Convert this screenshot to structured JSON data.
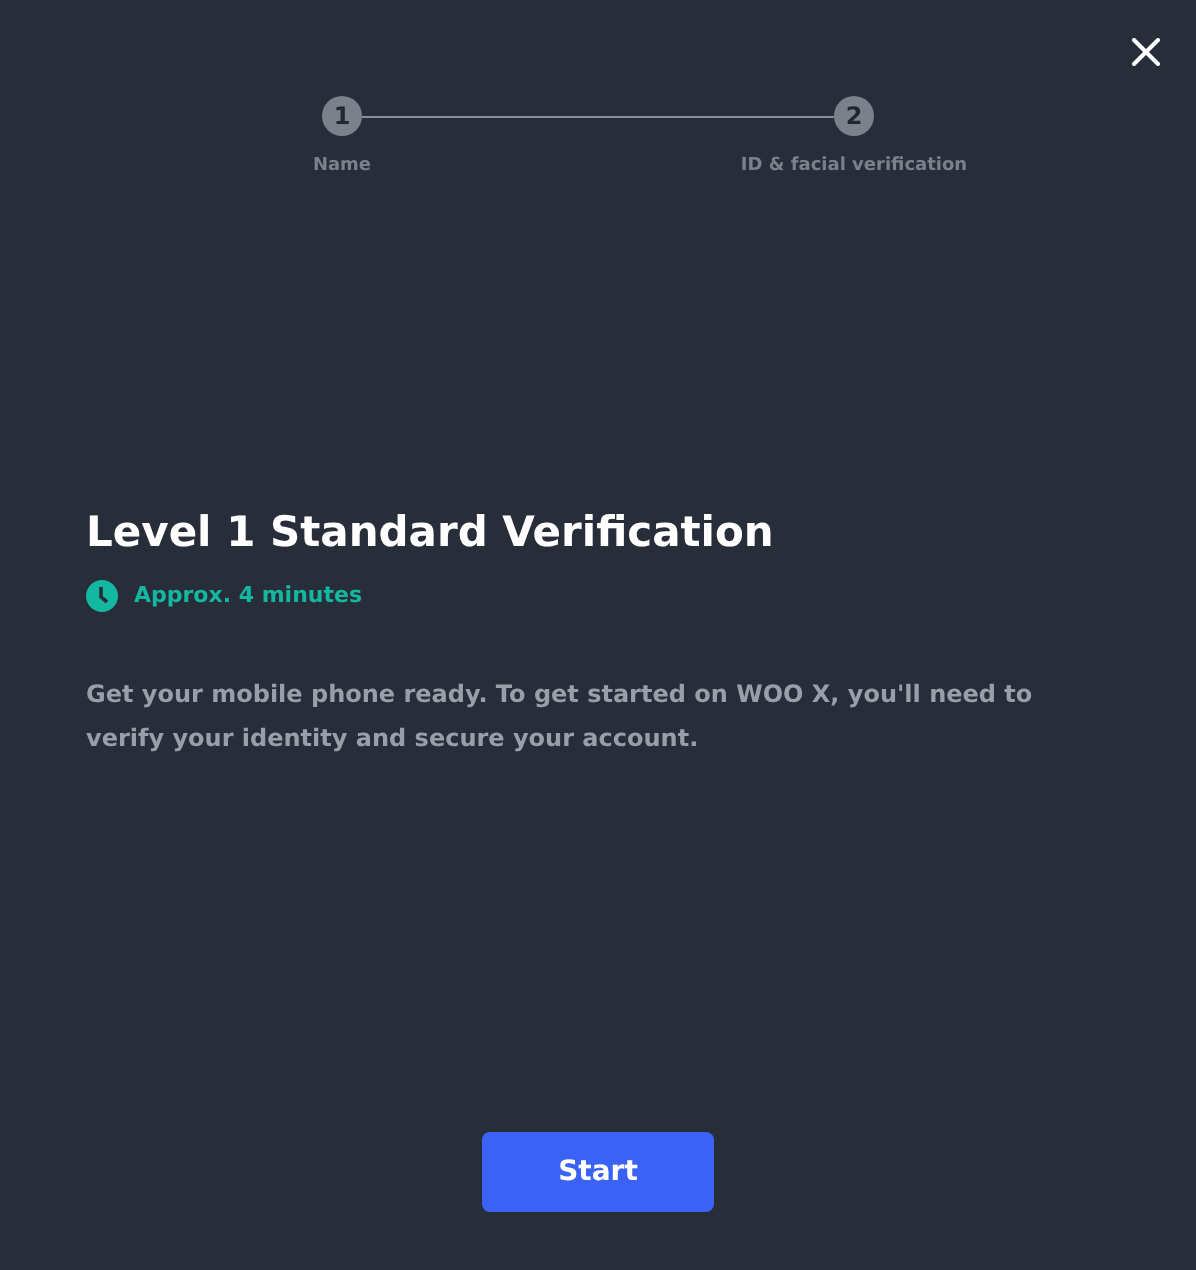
{
  "steps": [
    {
      "number": "1",
      "label": "Name"
    },
    {
      "number": "2",
      "label": "ID & facial verification"
    }
  ],
  "title": "Level 1 Standard Verification",
  "duration": "Approx. 4 minutes",
  "description": "Get your mobile phone ready. To get started on WOO X, you'll need to verify your identity and secure your account.",
  "button": "Start"
}
